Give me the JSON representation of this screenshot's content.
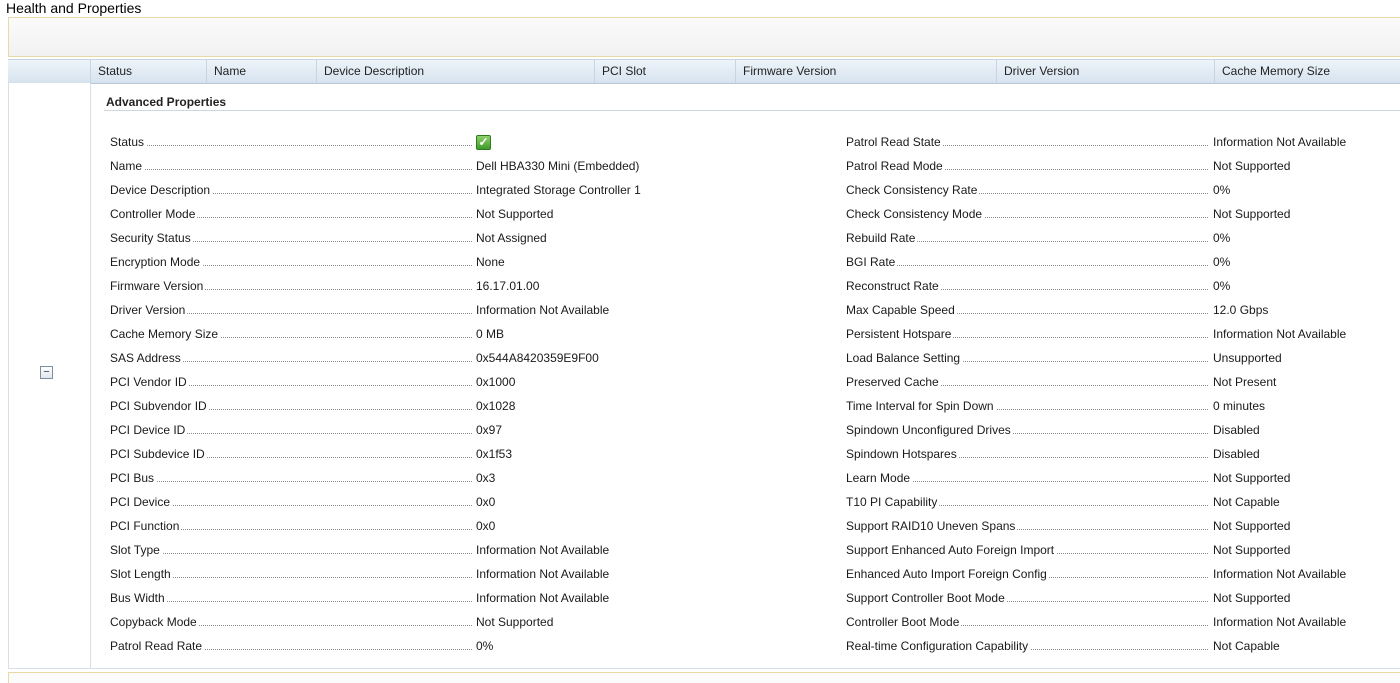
{
  "page": {
    "title": "Health and Properties"
  },
  "columns": [
    "Status",
    "Name",
    "Device Description",
    "PCI Slot",
    "Firmware Version",
    "Driver Version",
    "Cache Memory Size"
  ],
  "section": {
    "title": "Advanced Properties",
    "collapse_symbol": "−"
  },
  "status_icon": {
    "name": "status-ok-icon",
    "glyph": "✓",
    "color": "#3f9a2a"
  },
  "left_properties": [
    {
      "label": "Status",
      "value": ""
    },
    {
      "label": "Name",
      "value": "Dell HBA330 Mini (Embedded)"
    },
    {
      "label": "Device Description",
      "value": "Integrated Storage Controller 1"
    },
    {
      "label": "Controller Mode",
      "value": "Not Supported"
    },
    {
      "label": "Security Status",
      "value": "Not Assigned"
    },
    {
      "label": "Encryption Mode",
      "value": "None"
    },
    {
      "label": "Firmware Version",
      "value": "16.17.01.00"
    },
    {
      "label": "Driver Version",
      "value": "Information Not Available"
    },
    {
      "label": "Cache Memory Size",
      "value": "0 MB"
    },
    {
      "label": "SAS Address",
      "value": "0x544A8420359E9F00"
    },
    {
      "label": "PCI Vendor ID",
      "value": "0x1000"
    },
    {
      "label": "PCI Subvendor ID",
      "value": "0x1028"
    },
    {
      "label": "PCI Device ID",
      "value": "0x97"
    },
    {
      "label": "PCI Subdevice ID",
      "value": "0x1f53"
    },
    {
      "label": "PCI Bus",
      "value": "0x3"
    },
    {
      "label": "PCI Device",
      "value": "0x0"
    },
    {
      "label": "PCI Function",
      "value": "0x0"
    },
    {
      "label": "Slot Type",
      "value": "Information Not Available"
    },
    {
      "label": "Slot Length",
      "value": "Information Not Available"
    },
    {
      "label": "Bus Width",
      "value": "Information Not Available"
    },
    {
      "label": "Copyback Mode",
      "value": "Not Supported"
    },
    {
      "label": "Patrol Read Rate",
      "value": "0%"
    }
  ],
  "right_properties": [
    {
      "label": "Patrol Read State",
      "value": "Information Not Available"
    },
    {
      "label": "Patrol Read Mode",
      "value": "Not Supported"
    },
    {
      "label": "Check Consistency Rate",
      "value": "0%"
    },
    {
      "label": "Check Consistency Mode",
      "value": "Not Supported"
    },
    {
      "label": "Rebuild Rate",
      "value": "0%"
    },
    {
      "label": "BGI Rate",
      "value": "0%"
    },
    {
      "label": "Reconstruct Rate",
      "value": "0%"
    },
    {
      "label": "Max Capable Speed",
      "value": "12.0 Gbps"
    },
    {
      "label": "Persistent Hotspare",
      "value": "Information Not Available"
    },
    {
      "label": "Load Balance Setting",
      "value": "Unsupported"
    },
    {
      "label": "Preserved Cache",
      "value": "Not Present"
    },
    {
      "label": "Time Interval for Spin Down",
      "value": "0 minutes"
    },
    {
      "label": "Spindown Unconfigured Drives",
      "value": "Disabled"
    },
    {
      "label": "Spindown Hotspares",
      "value": "Disabled"
    },
    {
      "label": "Learn Mode",
      "value": "Not Supported"
    },
    {
      "label": "T10 PI Capability",
      "value": "Not Capable"
    },
    {
      "label": "Support RAID10 Uneven Spans",
      "value": "Not Supported"
    },
    {
      "label": "Support Enhanced Auto Foreign Import",
      "value": "Not Supported"
    },
    {
      "label": "Enhanced Auto Import Foreign Config",
      "value": "Information Not Available"
    },
    {
      "label": "Support Controller Boot Mode",
      "value": "Not Supported"
    },
    {
      "label": "Controller Boot Mode",
      "value": "Information Not Available"
    },
    {
      "label": "Real-time Configuration Capability",
      "value": "Not Capable"
    }
  ]
}
